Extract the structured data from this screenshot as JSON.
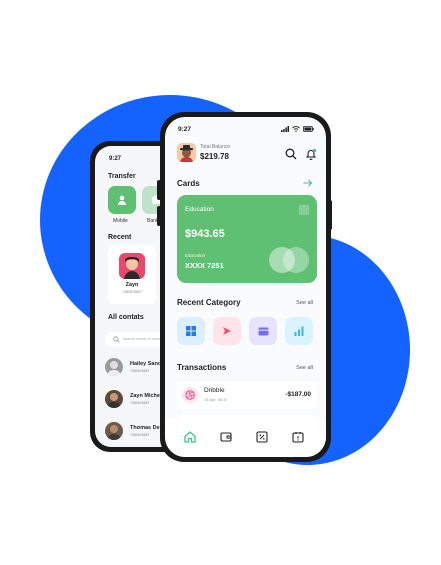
{
  "colors": {
    "accent_blue": "#1463ff",
    "card_green": "#5fbf73",
    "nav_active": "#3cc48a"
  },
  "back_phone": {
    "time": "9:27",
    "transfer_title": "Transfer",
    "transfer_options": [
      {
        "label": "Mobile",
        "icon": "user-icon"
      },
      {
        "label": "Bank",
        "icon": "bank-icon"
      }
    ],
    "recent_title": "Recent",
    "recent_contact": {
      "name": "Zayn",
      "number": "+380678657"
    },
    "all_contacts_title": "All contats",
    "search_placeholder": "search name or number",
    "contacts": [
      {
        "name": "Hailey Sand",
        "number": "+380678657"
      },
      {
        "name": "Zayn Michel",
        "number": "+380678657"
      },
      {
        "name": "Thomas Den",
        "number": "+380678657"
      }
    ]
  },
  "front_phone": {
    "time": "9:27",
    "balance_label": "Total Balance",
    "balance_value": "$219.78",
    "cards_title": "Cards",
    "card": {
      "name": "Education",
      "amount": "$943.65",
      "sub_label": "Education",
      "number": "XXXX 7251"
    },
    "category_title": "Recent Category",
    "category_see_all": "See all",
    "categories": [
      {
        "icon": "windows-icon",
        "bg": "#dcefff",
        "fg": "#2a7be0"
      },
      {
        "icon": "send-icon",
        "bg": "#ffe4ec",
        "fg": "#f04a7a"
      },
      {
        "icon": "card-icon",
        "bg": "#e6e3ff",
        "fg": "#7a6ce8"
      },
      {
        "icon": "chart-icon",
        "bg": "#d9f4ff",
        "fg": "#35b6e6"
      }
    ],
    "transactions_title": "Transactions",
    "transactions_see_all": "See all",
    "transactions": [
      {
        "name": "Dribble",
        "date": "15 Apr, 08:37",
        "amount": "-$187.00",
        "icon": "dribbble-icon"
      }
    ],
    "nav": [
      {
        "name": "home",
        "icon": "home-icon",
        "active": true
      },
      {
        "name": "wallet",
        "icon": "wallet-icon",
        "active": false
      },
      {
        "name": "discount",
        "icon": "percent-icon",
        "active": false
      },
      {
        "name": "calendar",
        "icon": "calendar-icon",
        "active": false
      }
    ]
  }
}
